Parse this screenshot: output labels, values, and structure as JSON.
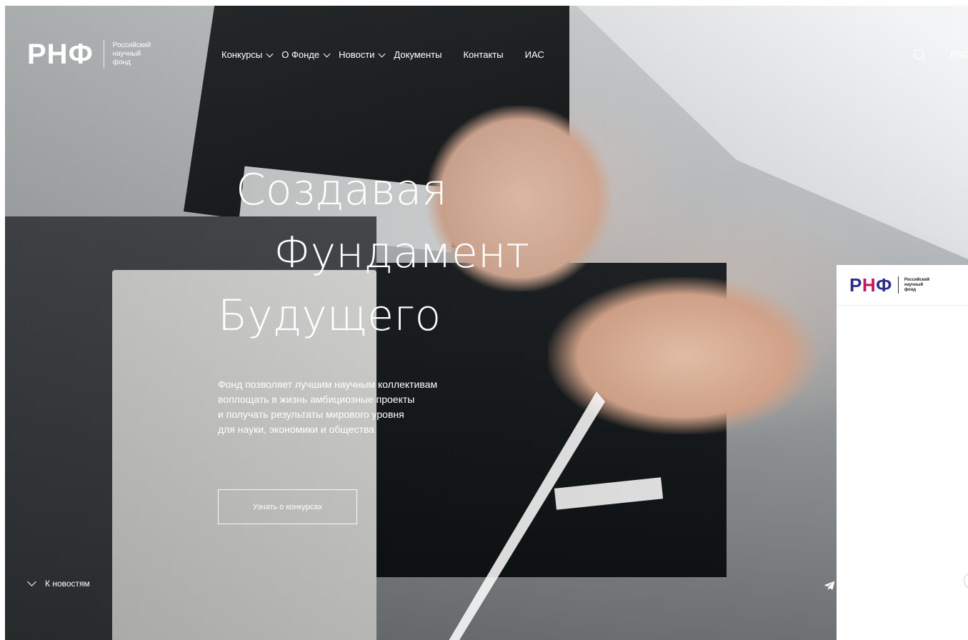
{
  "brand": {
    "mark": "РНФ",
    "sub_lines": [
      "Российский",
      "научный",
      "фонд"
    ]
  },
  "nav": {
    "items": [
      {
        "label": "Конкурсы",
        "dropdown": true
      },
      {
        "label": "О Фонде",
        "dropdown": true
      },
      {
        "label": "Новости",
        "dropdown": true
      },
      {
        "label": "Документы",
        "dropdown": false
      },
      {
        "label": "Контакты",
        "dropdown": false
      },
      {
        "label": "ИАС",
        "dropdown": false
      }
    ],
    "lang": "ENG",
    "search_icon": "search-icon"
  },
  "hero": {
    "headline": [
      "Создавая",
      "Фундамент",
      "Будущего"
    ],
    "lead": [
      "Фонд позволяет лучшим научным коллективам",
      "воплощать в жизнь амбициозные проекты",
      "и получать результаты мирового уровня",
      "для науки, экономики и общества"
    ],
    "cta": "Узнать о конкурсах",
    "to_news": "К новостям"
  },
  "panel": {
    "mark_parts": [
      "Р",
      "Н",
      "Ф"
    ],
    "sub_lines": [
      "Российский",
      "научный",
      "фонд"
    ],
    "colors": {
      "primary": "#2c2f8d",
      "accent": "#c3165f"
    }
  }
}
